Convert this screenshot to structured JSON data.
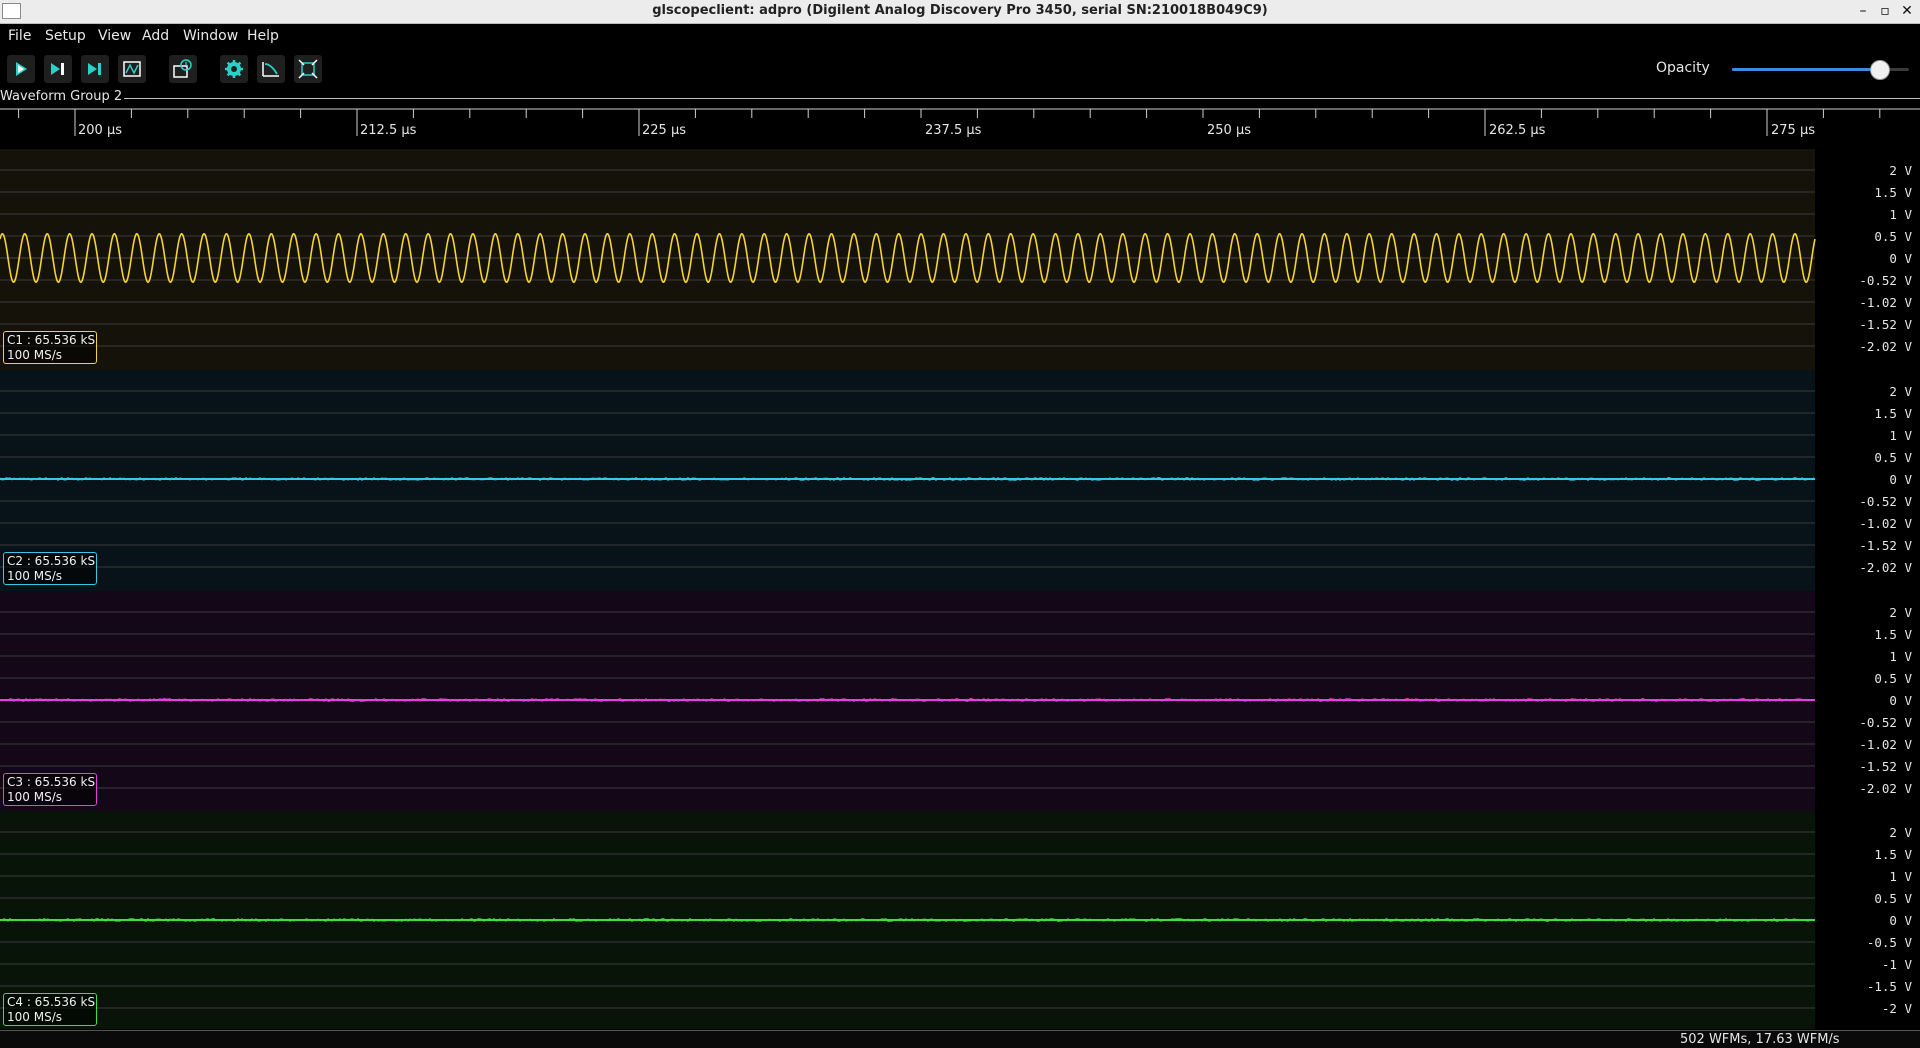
{
  "window": {
    "title": "glscopeclient: adpro (Digilent Analog Discovery Pro 3450, serial SN:210018B049C9)",
    "minimize": "–",
    "maximize": "▫",
    "close": "✕"
  },
  "menu": [
    "File",
    "Setup",
    "View",
    "Add",
    "Window",
    "Help"
  ],
  "toolbar": {
    "buttons": [
      {
        "name": "start-trigger",
        "icon": "play-icon"
      },
      {
        "name": "single-trigger",
        "icon": "step-icon"
      },
      {
        "name": "force-trigger",
        "icon": "force-icon"
      },
      {
        "name": "stop-trigger",
        "icon": "stop-icon"
      },
      {
        "name": "history",
        "icon": "history-icon"
      },
      {
        "name": "refresh-settings",
        "icon": "gear-icon"
      },
      {
        "name": "clear-sweeps",
        "icon": "sweep-icon"
      },
      {
        "name": "fullscreen",
        "icon": "fullscreen-icon"
      }
    ],
    "opacity_label": "Opacity",
    "opacity_value": 0.83
  },
  "group": {
    "title": "Waveform Group 2",
    "timebase_labels": [
      "200 µs",
      "212.5 µs",
      "225 µs",
      "237.5 µs",
      "250 µs",
      "262.5 µs",
      "275 µs"
    ]
  },
  "channels": [
    {
      "name": "C1",
      "info_line1": "C1 : 65.536 kS",
      "info_line2": "100 MS/s",
      "color": "#f5d431",
      "bg": "#15120a",
      "axis_labels": [
        "2 V",
        "1.5 V",
        "1 V",
        "0.5 V",
        "0 V",
        "-0.52 V",
        "-1.02 V",
        "-1.52 V",
        "-2.02 V"
      ],
      "signal": "sine",
      "amplitude_v": 0.55,
      "cycles": 81
    },
    {
      "name": "C2",
      "info_line1": "C2 : 65.536 kS",
      "info_line2": "100 MS/s",
      "color": "#39c8e8",
      "bg": "#071318",
      "axis_labels": [
        "2 V",
        "1.5 V",
        "1 V",
        "0.5 V",
        "0 V",
        "-0.52 V",
        "-1.02 V",
        "-1.52 V",
        "-2.02 V"
      ],
      "signal": "flat",
      "amplitude_v": 0.0
    },
    {
      "name": "C3",
      "info_line1": "C3 : 65.536 kS",
      "info_line2": "100 MS/s",
      "color": "#e83fe0",
      "bg": "#140818",
      "axis_labels": [
        "2 V",
        "1.5 V",
        "1 V",
        "0.5 V",
        "0 V",
        "-0.52 V",
        "-1.02 V",
        "-1.52 V",
        "-2.02 V"
      ],
      "signal": "flat",
      "amplitude_v": 0.0
    },
    {
      "name": "C4",
      "info_line1": "C4 : 65.536 kS",
      "info_line2": "100 MS/s",
      "color": "#3ee03e",
      "bg": "#081408",
      "axis_labels": [
        "2 V",
        "1.5 V",
        "1 V",
        "0.5 V",
        "0 V",
        "-0.5 V",
        "-1 V",
        "-1.5 V",
        "-2 V"
      ],
      "signal": "flat",
      "amplitude_v": 0.0
    }
  ],
  "status": "502 WFMs, 17.63 WFM/s"
}
